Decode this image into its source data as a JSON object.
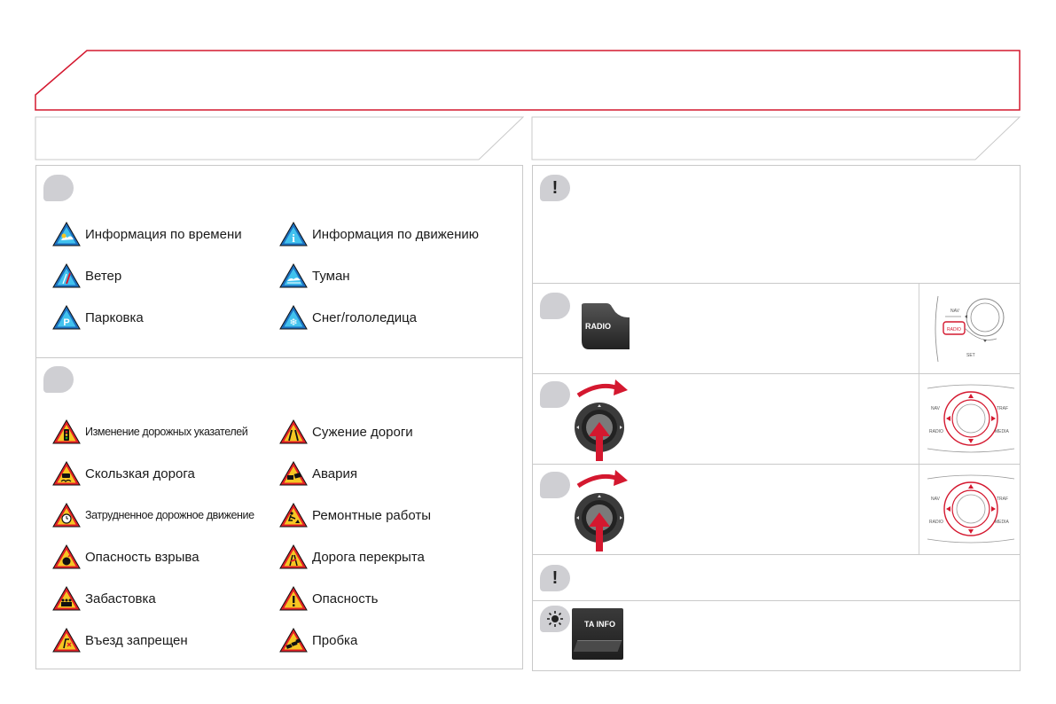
{
  "weather_items": [
    {
      "label": "Информация по времени",
      "icon": "weather-info-icon"
    },
    {
      "label": "Информация по движению",
      "icon": "traffic-info-icon"
    },
    {
      "label": "Ветер",
      "icon": "wind-icon"
    },
    {
      "label": "Туман",
      "icon": "fog-icon"
    },
    {
      "label": "Парковка",
      "icon": "parking-icon"
    },
    {
      "label": "Снег/гололедица",
      "icon": "snow-ice-icon"
    }
  ],
  "warning_items": [
    {
      "label": "Изменение дорожных указателей",
      "icon": "traffic-light-warning-icon"
    },
    {
      "label": "Сужение дороги",
      "icon": "road-narrows-icon"
    },
    {
      "label": "Скользкая дорога",
      "icon": "slippery-road-icon"
    },
    {
      "label": "Авария",
      "icon": "accident-icon"
    },
    {
      "label": "Затрудненное дорожное движение",
      "icon": "congestion-icon"
    },
    {
      "label": "Ремонтные работы",
      "icon": "roadworks-icon"
    },
    {
      "label": "Опасность взрыва",
      "icon": "explosion-icon"
    },
    {
      "label": "Дорога перекрыта",
      "icon": "road-closed-icon"
    },
    {
      "label": "Забастовка",
      "icon": "strike-icon"
    },
    {
      "label": "Опасность",
      "icon": "danger-icon"
    },
    {
      "label": "Въезд запрещен",
      "icon": "no-entry-icon"
    },
    {
      "label": "Пробка",
      "icon": "traffic-jam-icon"
    }
  ],
  "buttons": {
    "radio_label": "RADIO",
    "ta_info_label": "TA INFO"
  },
  "panel_labels": {
    "nav": "NAV",
    "radio": "RADIO",
    "set": "SET",
    "traf": "TRAF",
    "media": "MEDIA"
  },
  "alert_glyph": "!",
  "colors": {
    "accent_red": "#d4182f",
    "warning_red": "#e21f26",
    "warning_yellow": "#f6c623",
    "info_blue": "#1c6fbf",
    "info_cyan": "#41c2ee"
  }
}
